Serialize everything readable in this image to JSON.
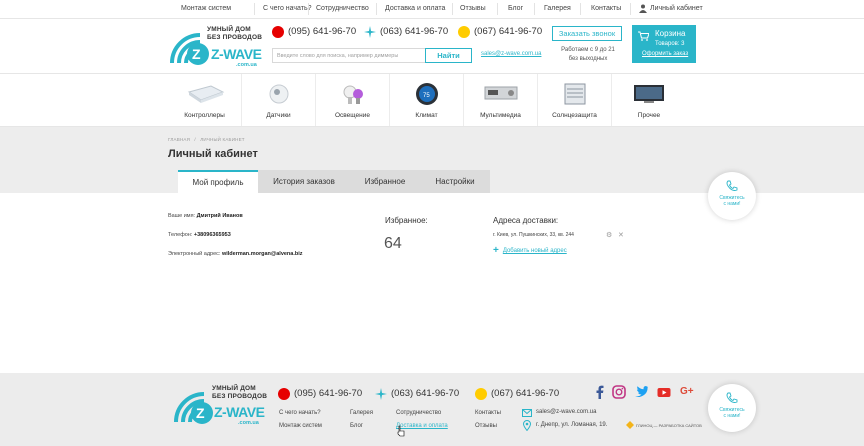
{
  "topnav": {
    "items": [
      "Монтаж систем",
      "С чего начать?",
      "Сотрудничество",
      "Доставка и оплата",
      "Отзывы",
      "Блог",
      "Галерея",
      "Контакты"
    ],
    "account": "Личный кабинет"
  },
  "brand": {
    "tagline_1": "УМНЫЙ ДОМ",
    "tagline_2": "БЕЗ ПРОВОДОВ",
    "logo_text": "Z-WAVE",
    "logo_sub": ".com.ua",
    "accent": "#2ab5c9"
  },
  "phones": [
    "(095) 641-96-70",
    "(063) 641-96-70",
    "(067) 641-96-70"
  ],
  "search": {
    "placeholder": "Введите слово для поиска, например диммеры",
    "button": "Найти"
  },
  "email": "sales@z-wave.com.ua",
  "callback": "Заказать звонок",
  "hours": {
    "line1": "Работаем с 9 до 21",
    "line2": "без выходных"
  },
  "cart": {
    "title": "Корзина",
    "count": "Товаров: 3",
    "order": "Оформить заказ"
  },
  "categories": [
    "Контроллеры",
    "Датчики",
    "Освещение",
    "Климат",
    "Мультимедиа",
    "Солнцезащита",
    "Прочее"
  ],
  "breadcrumb": {
    "home": "ГЛАВНАЯ",
    "sep": "/",
    "current": "ЛИЧНЫЙ КАБИНЕТ"
  },
  "page_title": "Личный кабинет",
  "tabs": [
    "Мой профиль",
    "История заказов",
    "Избранное",
    "Настройки"
  ],
  "profile": {
    "name_label": "Ваше имя:",
    "name": "Дмитрий Иванов",
    "phone_label": "Телефон:",
    "phone": "+38096365953",
    "email_label": "Электронный адрес:",
    "email": "wilderman.morgan@alvena.biz"
  },
  "favorites": {
    "title": "Избранное:",
    "count": "64"
  },
  "addresses": {
    "title": "Адреса доставки:",
    "items": [
      "г. Киев, ул. Пушкинских, 33, кв. 244"
    ],
    "add": "Добавить новый адрес"
  },
  "float_contact": {
    "line1": "Свяжитесь",
    "line2": "с нами!"
  },
  "footer": {
    "phones": [
      "(095) 641-96-70",
      "(063) 641-96-70",
      "(067) 641-96-70"
    ],
    "links_col1": [
      "С чего начать?",
      "Монтаж систем"
    ],
    "links_col2": [
      "Галерея",
      "Блог"
    ],
    "links_col3": [
      "Сотрудничество",
      "Доставка и оплата"
    ],
    "links_col4": [
      "Контакты",
      "Отзывы"
    ],
    "email": "sales@z-wave.com.ua",
    "address": "г. Днепр, ул. Ломаная, 19.",
    "dev": "ГЛИНОЦ — РАЗРАБОТКА САЙТОВ"
  }
}
